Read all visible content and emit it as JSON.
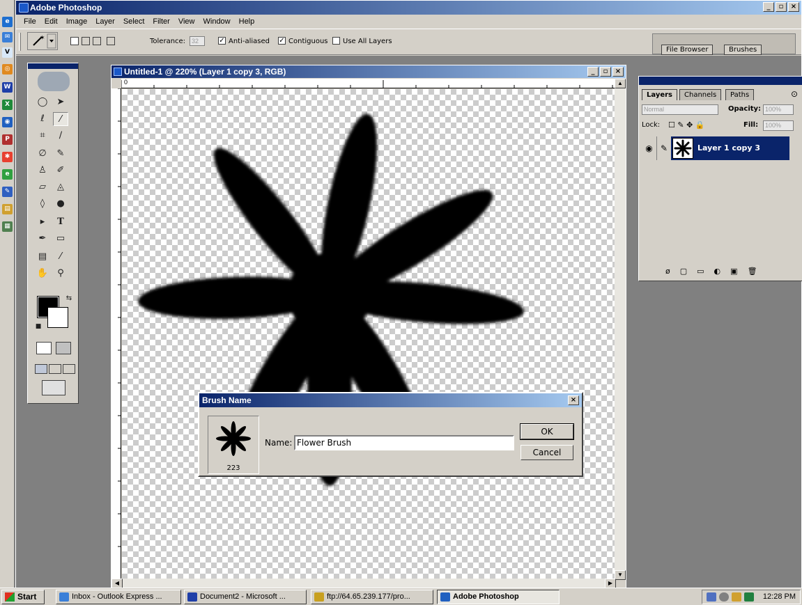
{
  "app": {
    "title": "Adobe Photoshop"
  },
  "menu": [
    "File",
    "Edit",
    "Image",
    "Layer",
    "Select",
    "Filter",
    "View",
    "Window",
    "Help"
  ],
  "options": {
    "tolerance_label": "Tolerance:",
    "tolerance_value": "32",
    "anti_aliased": "Anti-aliased",
    "contiguous": "Contiguous",
    "use_all_layers": "Use All Layers",
    "file_browser_tab": "File Browser",
    "brushes_tab": "Brushes"
  },
  "document": {
    "title": "Untitled-1 @ 220% (Layer 1 copy 3, RGB)",
    "ruler_origin": "0"
  },
  "dialog": {
    "title": "Brush Name",
    "size_label": "223",
    "name_label": "Name:",
    "name_value": "Flower Brush",
    "ok": "OK",
    "cancel": "Cancel"
  },
  "layers": {
    "tabs": [
      "Layers",
      "Channels",
      "Paths"
    ],
    "blend_mode": "Normal",
    "opacity_label": "Opacity:",
    "opacity_value": "100%",
    "lock_label": "Lock:",
    "fill_label": "Fill:",
    "fill_value": "100%",
    "layer_name": "Layer 1 copy 3"
  },
  "taskbar": {
    "start": "Start",
    "tasks": [
      "Inbox - Outlook Express ...",
      "Document2 - Microsoft ...",
      "ftp://64.65.239.177/pro...",
      "Adobe Photoshop"
    ],
    "clock": "12:28 PM"
  },
  "colors": {
    "title_active": "#0a246a",
    "title_end": "#a6caf0",
    "face": "#d4d0c8",
    "workspace": "#808080"
  },
  "icons": [
    "ie-icon",
    "outlook-icon",
    "vnc-icon",
    "word-icon",
    "excel-icon",
    "photoshop-icon"
  ]
}
